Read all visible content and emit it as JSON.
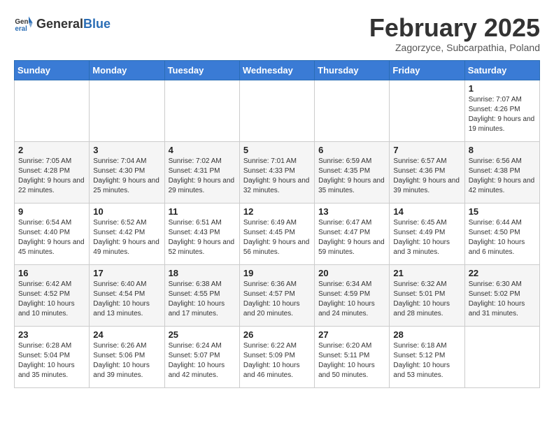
{
  "logo": {
    "general": "General",
    "blue": "Blue"
  },
  "header": {
    "month": "February 2025",
    "location": "Zagorzyce, Subcarpathia, Poland"
  },
  "weekdays": [
    "Sunday",
    "Monday",
    "Tuesday",
    "Wednesday",
    "Thursday",
    "Friday",
    "Saturday"
  ],
  "weeks": [
    [
      {
        "day": "",
        "info": ""
      },
      {
        "day": "",
        "info": ""
      },
      {
        "day": "",
        "info": ""
      },
      {
        "day": "",
        "info": ""
      },
      {
        "day": "",
        "info": ""
      },
      {
        "day": "",
        "info": ""
      },
      {
        "day": "1",
        "info": "Sunrise: 7:07 AM\nSunset: 4:26 PM\nDaylight: 9 hours and 19 minutes."
      }
    ],
    [
      {
        "day": "2",
        "info": "Sunrise: 7:05 AM\nSunset: 4:28 PM\nDaylight: 9 hours and 22 minutes."
      },
      {
        "day": "3",
        "info": "Sunrise: 7:04 AM\nSunset: 4:30 PM\nDaylight: 9 hours and 25 minutes."
      },
      {
        "day": "4",
        "info": "Sunrise: 7:02 AM\nSunset: 4:31 PM\nDaylight: 9 hours and 29 minutes."
      },
      {
        "day": "5",
        "info": "Sunrise: 7:01 AM\nSunset: 4:33 PM\nDaylight: 9 hours and 32 minutes."
      },
      {
        "day": "6",
        "info": "Sunrise: 6:59 AM\nSunset: 4:35 PM\nDaylight: 9 hours and 35 minutes."
      },
      {
        "day": "7",
        "info": "Sunrise: 6:57 AM\nSunset: 4:36 PM\nDaylight: 9 hours and 39 minutes."
      },
      {
        "day": "8",
        "info": "Sunrise: 6:56 AM\nSunset: 4:38 PM\nDaylight: 9 hours and 42 minutes."
      }
    ],
    [
      {
        "day": "9",
        "info": "Sunrise: 6:54 AM\nSunset: 4:40 PM\nDaylight: 9 hours and 45 minutes."
      },
      {
        "day": "10",
        "info": "Sunrise: 6:52 AM\nSunset: 4:42 PM\nDaylight: 9 hours and 49 minutes."
      },
      {
        "day": "11",
        "info": "Sunrise: 6:51 AM\nSunset: 4:43 PM\nDaylight: 9 hours and 52 minutes."
      },
      {
        "day": "12",
        "info": "Sunrise: 6:49 AM\nSunset: 4:45 PM\nDaylight: 9 hours and 56 minutes."
      },
      {
        "day": "13",
        "info": "Sunrise: 6:47 AM\nSunset: 4:47 PM\nDaylight: 9 hours and 59 minutes."
      },
      {
        "day": "14",
        "info": "Sunrise: 6:45 AM\nSunset: 4:49 PM\nDaylight: 10 hours and 3 minutes."
      },
      {
        "day": "15",
        "info": "Sunrise: 6:44 AM\nSunset: 4:50 PM\nDaylight: 10 hours and 6 minutes."
      }
    ],
    [
      {
        "day": "16",
        "info": "Sunrise: 6:42 AM\nSunset: 4:52 PM\nDaylight: 10 hours and 10 minutes."
      },
      {
        "day": "17",
        "info": "Sunrise: 6:40 AM\nSunset: 4:54 PM\nDaylight: 10 hours and 13 minutes."
      },
      {
        "day": "18",
        "info": "Sunrise: 6:38 AM\nSunset: 4:55 PM\nDaylight: 10 hours and 17 minutes."
      },
      {
        "day": "19",
        "info": "Sunrise: 6:36 AM\nSunset: 4:57 PM\nDaylight: 10 hours and 20 minutes."
      },
      {
        "day": "20",
        "info": "Sunrise: 6:34 AM\nSunset: 4:59 PM\nDaylight: 10 hours and 24 minutes."
      },
      {
        "day": "21",
        "info": "Sunrise: 6:32 AM\nSunset: 5:01 PM\nDaylight: 10 hours and 28 minutes."
      },
      {
        "day": "22",
        "info": "Sunrise: 6:30 AM\nSunset: 5:02 PM\nDaylight: 10 hours and 31 minutes."
      }
    ],
    [
      {
        "day": "23",
        "info": "Sunrise: 6:28 AM\nSunset: 5:04 PM\nDaylight: 10 hours and 35 minutes."
      },
      {
        "day": "24",
        "info": "Sunrise: 6:26 AM\nSunset: 5:06 PM\nDaylight: 10 hours and 39 minutes."
      },
      {
        "day": "25",
        "info": "Sunrise: 6:24 AM\nSunset: 5:07 PM\nDaylight: 10 hours and 42 minutes."
      },
      {
        "day": "26",
        "info": "Sunrise: 6:22 AM\nSunset: 5:09 PM\nDaylight: 10 hours and 46 minutes."
      },
      {
        "day": "27",
        "info": "Sunrise: 6:20 AM\nSunset: 5:11 PM\nDaylight: 10 hours and 50 minutes."
      },
      {
        "day": "28",
        "info": "Sunrise: 6:18 AM\nSunset: 5:12 PM\nDaylight: 10 hours and 53 minutes."
      },
      {
        "day": "",
        "info": ""
      }
    ]
  ]
}
